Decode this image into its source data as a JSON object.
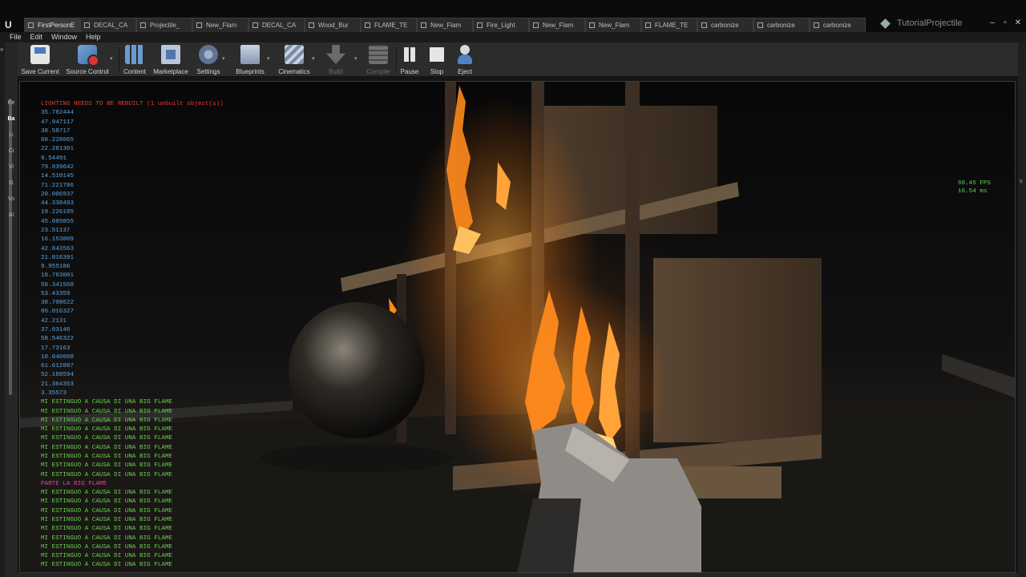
{
  "app": {
    "project_name": "TutorialProjectile"
  },
  "tabs": [
    {
      "label": "FirstPersonE",
      "active": true
    },
    {
      "label": "DECAL_CA",
      "active": false
    },
    {
      "label": "Projectile_",
      "active": false
    },
    {
      "label": "New_Flam",
      "active": false
    },
    {
      "label": "DECAL_CA",
      "active": false
    },
    {
      "label": "Wood_Bur",
      "active": false
    },
    {
      "label": "FLAME_TE",
      "active": false
    },
    {
      "label": "New_Flam",
      "active": false
    },
    {
      "label": "Fire_Light",
      "active": false
    },
    {
      "label": "New_Flam",
      "active": false
    },
    {
      "label": "New_Flam",
      "active": false
    },
    {
      "label": "FLAME_TE",
      "active": false
    },
    {
      "label": "carbonize",
      "active": false
    },
    {
      "label": "carbonize",
      "active": false
    },
    {
      "label": "carbonize",
      "active": false
    }
  ],
  "menu": [
    "File",
    "Edit",
    "Window",
    "Help"
  ],
  "toolbar": {
    "save_current": "Save Current",
    "source_control": "Source Control",
    "content": "Content",
    "marketplace": "Marketplace",
    "settings": "Settings",
    "blueprints": "Blueprints",
    "cinematics": "Cinematics",
    "build": "Build",
    "compile": "Compile",
    "pause": "Pause",
    "stop": "Stop",
    "eject": "Eject"
  },
  "modes_tabs": [
    "Re",
    "Ba",
    "Li",
    "Ci",
    "Vi",
    "G",
    "Vo",
    "Al"
  ],
  "viewport": {
    "warning": "LIGHTING NEEDS TO BE REBUILT (1 unbuilt object(s))",
    "fps": "60.45 FPS",
    "frame_ms": "16.54 ms",
    "log": [
      {
        "text": "35.782444",
        "kind": "num"
      },
      {
        "text": "47.947117",
        "kind": "num"
      },
      {
        "text": "38.58717",
        "kind": "num"
      },
      {
        "text": "60.228065",
        "kind": "num"
      },
      {
        "text": "22.281301",
        "kind": "num"
      },
      {
        "text": "9.54491",
        "kind": "num"
      },
      {
        "text": "79.039642",
        "kind": "num"
      },
      {
        "text": "14.510145",
        "kind": "num"
      },
      {
        "text": "71.221786",
        "kind": "num"
      },
      {
        "text": "20.006937",
        "kind": "num"
      },
      {
        "text": "44.338493",
        "kind": "num"
      },
      {
        "text": "19.226185",
        "kind": "num"
      },
      {
        "text": "45.089855",
        "kind": "num"
      },
      {
        "text": "23.51137",
        "kind": "num"
      },
      {
        "text": "16.153009",
        "kind": "num"
      },
      {
        "text": "42.843563",
        "kind": "num"
      },
      {
        "text": "21.816391",
        "kind": "num"
      },
      {
        "text": "9.955186",
        "kind": "num"
      },
      {
        "text": "10.763001",
        "kind": "num"
      },
      {
        "text": "50.341568",
        "kind": "num"
      },
      {
        "text": "53.43359",
        "kind": "num"
      },
      {
        "text": "38.708622",
        "kind": "num"
      },
      {
        "text": "86.016327",
        "kind": "num"
      },
      {
        "text": "42.2131",
        "kind": "num"
      },
      {
        "text": "37.03146",
        "kind": "num"
      },
      {
        "text": "58.546322",
        "kind": "num"
      },
      {
        "text": "17.73163",
        "kind": "num"
      },
      {
        "text": "10.040068",
        "kind": "num"
      },
      {
        "text": "61.612087",
        "kind": "num"
      },
      {
        "text": "52.168594",
        "kind": "num"
      },
      {
        "text": "21.364353",
        "kind": "num"
      },
      {
        "text": "3.35573",
        "kind": "num"
      },
      {
        "text": "MI ESTINGUO A CAUSA DI UNA BIG FLAME",
        "kind": "green"
      },
      {
        "text": "MI ESTINGUO A CAUSA DI UNA BIG FLAME",
        "kind": "green"
      },
      {
        "text": "MI ESTINGUO A CAUSA DI UNA BIG FLAME",
        "kind": "green"
      },
      {
        "text": "MI ESTINGUO A CAUSA DI UNA BIG FLAME",
        "kind": "green"
      },
      {
        "text": "MI ESTINGUO A CAUSA DI UNA BIG FLAME",
        "kind": "green"
      },
      {
        "text": "MI ESTINGUO A CAUSA DI UNA BIG FLAME",
        "kind": "green"
      },
      {
        "text": "MI ESTINGUO A CAUSA DI UNA BIG FLAME",
        "kind": "green"
      },
      {
        "text": "MI ESTINGUO A CAUSA DI UNA BIG FLAME",
        "kind": "green"
      },
      {
        "text": "MI ESTINGUO A CAUSA DI UNA BIG FLAME",
        "kind": "green"
      },
      {
        "text": "PARTE LA BIG FLAME",
        "kind": "pink"
      },
      {
        "text": "MI ESTINGUO A CAUSA DI UNA BIG FLAME",
        "kind": "green"
      },
      {
        "text": "MI ESTINGUO A CAUSA DI UNA BIG FLAME",
        "kind": "green"
      },
      {
        "text": "MI ESTINGUO A CAUSA DI UNA BIG FLAME",
        "kind": "green"
      },
      {
        "text": "MI ESTINGUO A CAUSA DI UNA BIG FLAME",
        "kind": "green"
      },
      {
        "text": "MI ESTINGUO A CAUSA DI UNA BIG FLAME",
        "kind": "green"
      },
      {
        "text": "MI ESTINGUO A CAUSA DI UNA BIG FLAME",
        "kind": "green"
      },
      {
        "text": "MI ESTINGUO A CAUSA DI UNA BIG FLAME",
        "kind": "green"
      },
      {
        "text": "MI ESTINGUO A CAUSA DI UNA BIG FLAME",
        "kind": "green"
      },
      {
        "text": "MI ESTINGUO A CAUSA DI UNA BIG FLAME",
        "kind": "green"
      }
    ]
  },
  "colors": {
    "warning": "#e53838",
    "log_number": "#58a7e8",
    "log_green": "#66d24d",
    "log_pink": "#ef3fa3",
    "fps": "#5fd05f",
    "fire": "#ff8a1c"
  }
}
